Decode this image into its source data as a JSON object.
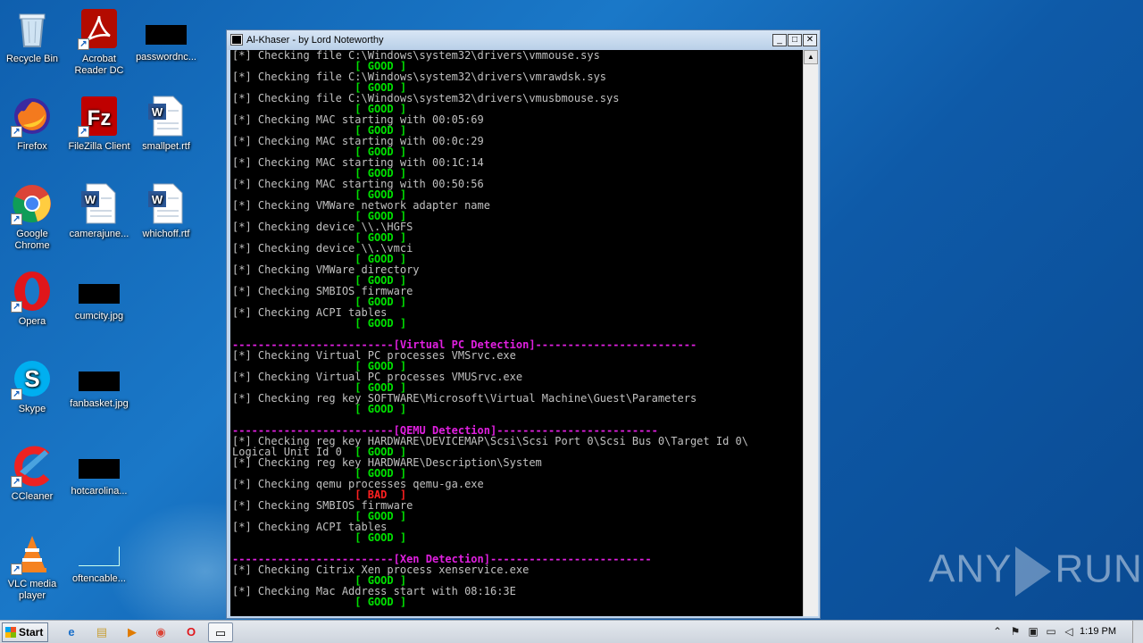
{
  "desktop": {
    "icons": [
      {
        "label": "Recycle Bin",
        "icon": "recycle-bin-icon"
      },
      {
        "label": "Acrobat Reader DC",
        "icon": "acrobat-icon"
      },
      {
        "label": "passwordnc...",
        "icon": "redacted-file-icon"
      },
      {
        "label": "Firefox",
        "icon": "firefox-icon"
      },
      {
        "label": "FileZilla Client",
        "icon": "filezilla-icon"
      },
      {
        "label": "smallpet.rtf",
        "icon": "word-doc-icon"
      },
      {
        "label": "Google Chrome",
        "icon": "chrome-icon"
      },
      {
        "label": "camerajune...",
        "icon": "word-doc-icon"
      },
      {
        "label": "whichoff.rtf",
        "icon": "word-doc-icon"
      },
      {
        "label": "Opera",
        "icon": "opera-icon"
      },
      {
        "label": "cumcity.jpg",
        "icon": "redacted-file-icon"
      },
      {
        "label": "Skype",
        "icon": "skype-icon"
      },
      {
        "label": "fanbasket.jpg",
        "icon": "redacted-file-icon"
      },
      {
        "label": "CCleaner",
        "icon": "ccleaner-icon"
      },
      {
        "label": "hotcarolina...",
        "icon": "redacted-file-icon"
      },
      {
        "label": "VLC media player",
        "icon": "vlc-icon"
      },
      {
        "label": "oftencable...",
        "icon": "blank-file-icon"
      }
    ]
  },
  "window": {
    "title": "Al-Khaser - by Lord Noteworthy",
    "buttons": {
      "minimize": "_",
      "maximize": "□",
      "close": "✕"
    }
  },
  "console_lines": [
    {
      "t": "[*] Checking file C:\\Windows\\system32\\drivers\\vmmouse.sys",
      "c": ""
    },
    {
      "t": "                   [ GOOD ]",
      "c": "good"
    },
    {
      "t": "[*] Checking file C:\\Windows\\system32\\drivers\\vmrawdsk.sys",
      "c": ""
    },
    {
      "t": "                   [ GOOD ]",
      "c": "good"
    },
    {
      "t": "[*] Checking file C:\\Windows\\system32\\drivers\\vmusbmouse.sys",
      "c": ""
    },
    {
      "t": "                   [ GOOD ]",
      "c": "good"
    },
    {
      "t": "[*] Checking MAC starting with 00:05:69",
      "c": ""
    },
    {
      "t": "                   [ GOOD ]",
      "c": "good"
    },
    {
      "t": "[*] Checking MAC starting with 00:0c:29",
      "c": ""
    },
    {
      "t": "                   [ GOOD ]",
      "c": "good"
    },
    {
      "t": "[*] Checking MAC starting with 00:1C:14",
      "c": ""
    },
    {
      "t": "                   [ GOOD ]",
      "c": "good"
    },
    {
      "t": "[*] Checking MAC starting with 00:50:56",
      "c": ""
    },
    {
      "t": "                   [ GOOD ]",
      "c": "good"
    },
    {
      "t": "[*] Checking VMWare network adapter name",
      "c": ""
    },
    {
      "t": "                   [ GOOD ]",
      "c": "good"
    },
    {
      "t": "[*] Checking device \\\\.\\HGFS",
      "c": ""
    },
    {
      "t": "                   [ GOOD ]",
      "c": "good"
    },
    {
      "t": "[*] Checking device \\\\.\\vmci",
      "c": ""
    },
    {
      "t": "                   [ GOOD ]",
      "c": "good"
    },
    {
      "t": "[*] Checking VMWare directory",
      "c": ""
    },
    {
      "t": "                   [ GOOD ]",
      "c": "good"
    },
    {
      "t": "[*] Checking SMBIOS firmware",
      "c": ""
    },
    {
      "t": "                   [ GOOD ]",
      "c": "good"
    },
    {
      "t": "[*] Checking ACPI tables",
      "c": ""
    },
    {
      "t": "                   [ GOOD ]",
      "c": "good"
    },
    {
      "t": "",
      "c": ""
    },
    {
      "t": "-------------------------[Virtual PC Detection]-------------------------",
      "c": "section"
    },
    {
      "t": "[*] Checking Virtual PC processes VMSrvc.exe",
      "c": ""
    },
    {
      "t": "                   [ GOOD ]",
      "c": "good"
    },
    {
      "t": "[*] Checking Virtual PC processes VMUSrvc.exe",
      "c": ""
    },
    {
      "t": "                   [ GOOD ]",
      "c": "good"
    },
    {
      "t": "[*] Checking reg key SOFTWARE\\Microsoft\\Virtual Machine\\Guest\\Parameters",
      "c": ""
    },
    {
      "t": "                   [ GOOD ]",
      "c": "good"
    },
    {
      "t": "",
      "c": ""
    },
    {
      "t": "-------------------------[QEMU Detection]-------------------------",
      "c": "section"
    },
    {
      "t": "[*] Checking reg key HARDWARE\\DEVICEMAP\\Scsi\\Scsi Port 0\\Scsi Bus 0\\Target Id 0\\",
      "c": ""
    },
    {
      "t": "Logical Unit Id 0  [ GOOD ]",
      "c": "mixed-good"
    },
    {
      "t": "[*] Checking reg key HARDWARE\\Description\\System",
      "c": ""
    },
    {
      "t": "                   [ GOOD ]",
      "c": "good"
    },
    {
      "t": "[*] Checking qemu processes qemu-ga.exe",
      "c": ""
    },
    {
      "t": "                   [ BAD  ]",
      "c": "bad"
    },
    {
      "t": "[*] Checking SMBIOS firmware",
      "c": ""
    },
    {
      "t": "                   [ GOOD ]",
      "c": "good"
    },
    {
      "t": "[*] Checking ACPI tables",
      "c": ""
    },
    {
      "t": "                   [ GOOD ]",
      "c": "good"
    },
    {
      "t": "",
      "c": ""
    },
    {
      "t": "-------------------------[Xen Detection]-------------------------",
      "c": "section"
    },
    {
      "t": "[*] Checking Citrix Xen process xenservice.exe",
      "c": ""
    },
    {
      "t": "                   [ GOOD ]",
      "c": "good"
    },
    {
      "t": "[*] Checking Mac Address start with 08:16:3E",
      "c": ""
    },
    {
      "t": "                   [ GOOD ]",
      "c": "good"
    }
  ],
  "watermark": {
    "left": "ANY",
    "right": "RUN"
  },
  "taskbar": {
    "start_label": "Start",
    "apps": [
      {
        "icon": "ie-icon",
        "glyph": "e"
      },
      {
        "icon": "explorer-icon",
        "glyph": "▤"
      },
      {
        "icon": "media-player-icon",
        "glyph": "▶"
      },
      {
        "icon": "chrome-icon",
        "glyph": "◉"
      },
      {
        "icon": "opera-icon",
        "glyph": "O"
      },
      {
        "icon": "console-icon",
        "glyph": "▭"
      }
    ],
    "clock": "1:19 PM"
  },
  "colors": {
    "good": "#00e000",
    "bad": "#ff2020",
    "section": "#e020e0",
    "console_bg": "#000000"
  }
}
